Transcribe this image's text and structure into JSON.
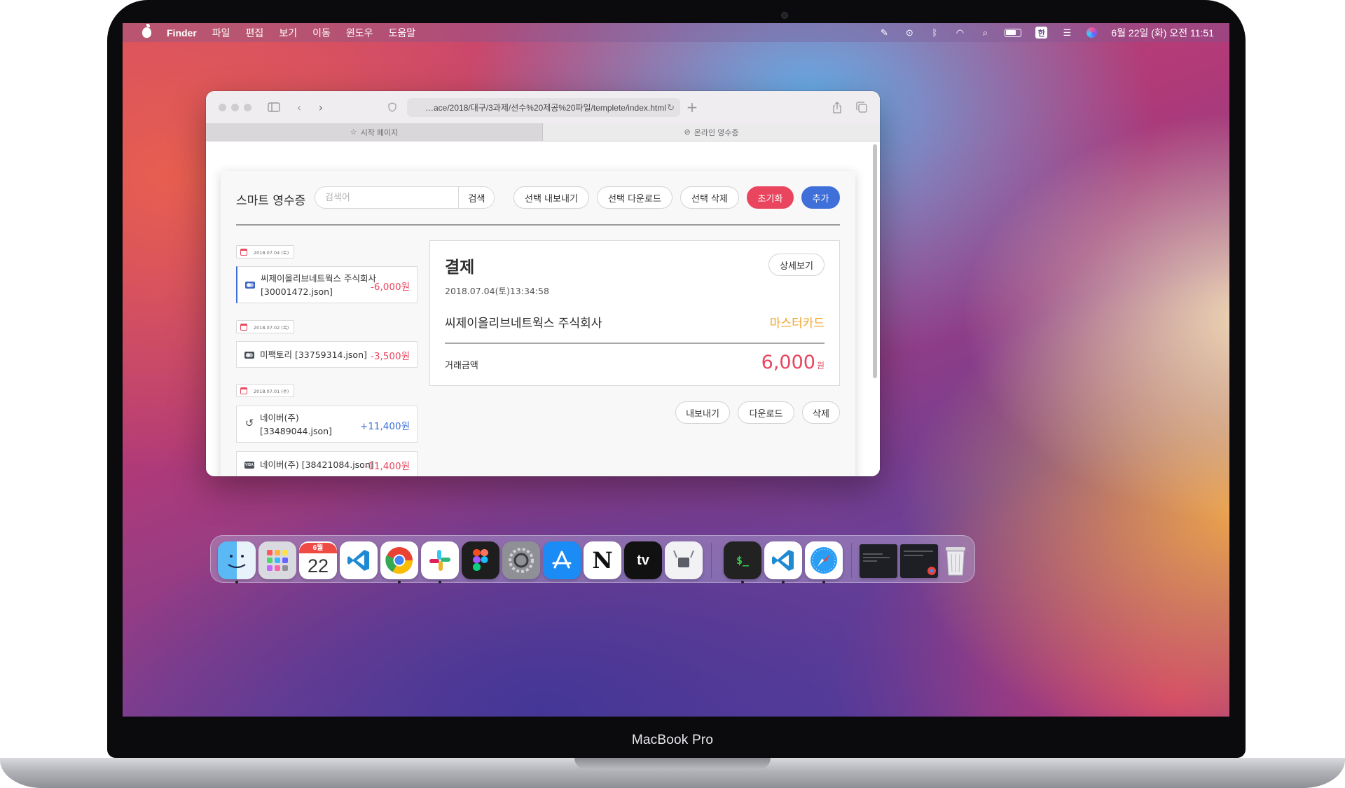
{
  "menubar": {
    "app_name": "Finder",
    "menus": [
      "파일",
      "편집",
      "보기",
      "이동",
      "윈도우",
      "도움말"
    ],
    "ime_label": "한",
    "clock": "6월 22일 (화) 오전 11:51"
  },
  "browser": {
    "url": "…ace/2018/대구/3과제/선수%20제공%20파일/templete/index.html",
    "tabs": [
      {
        "label": "시작 페이지",
        "icon": "star-icon"
      },
      {
        "label": "온라인 영수증",
        "icon": "compass-icon"
      }
    ]
  },
  "app": {
    "title": "스마트 영수증",
    "search": {
      "placeholder": "검색어",
      "button": "검색"
    },
    "toolbar": {
      "export_selected": "선택 내보내기",
      "download_selected": "선택 다운로드",
      "delete_selected": "선택 삭제",
      "reset": "초기화",
      "add": "추가"
    },
    "groups": [
      {
        "date": "2018.07.04 (토)"
      },
      {
        "date": "2018.07.02 (목)"
      },
      {
        "date": "2018.07.01 (수)"
      }
    ],
    "receipts": [
      {
        "name_line1": "씨제이올리브네트웍스 주식회사",
        "name_line2": "[30001472.json]",
        "amount": "-6,000원",
        "icon": "mastercard-icon"
      },
      {
        "name_line1": "미팩토리 [33759314.json]",
        "name_line2": "",
        "amount": "-3,500원",
        "icon": "card-icon"
      },
      {
        "name_line1": "네이버(주)",
        "name_line2": "[33489044.json]",
        "amount": "+11,400원",
        "icon": "refund-icon"
      },
      {
        "name_line1": "네이버(주) [38421084.json]",
        "name_line2": "",
        "amount": "-11,400원",
        "icon": "visa-icon"
      }
    ],
    "detail": {
      "title": "결제",
      "detail_button": "상세보기",
      "datetime": "2018.07.04(토)13:34:58",
      "merchant": "씨제이올리브네트웍스 주식회사",
      "card": "마스터카드",
      "amount_label": "거래금액",
      "amount": "6,000",
      "amount_unit": "원"
    },
    "actions": {
      "export": "내보내기",
      "download": "다운로드",
      "delete": "삭제"
    }
  },
  "dock": {
    "calendar_month": "6월",
    "calendar_day": "22",
    "apps": [
      "Finder",
      "Launchpad",
      "Calendar",
      "Visual Studio Code",
      "Google Chrome",
      "Slack",
      "Figma",
      "System Preferences",
      "App Store",
      "Notion",
      "Apple TV",
      "System Information",
      "Terminal",
      "Visual Studio Code",
      "Safari",
      "Trash"
    ],
    "appletv_label": "tv",
    "notion_label": "N",
    "terminal_label": "$_"
  },
  "device": {
    "label": "MacBook Pro"
  },
  "colors": {
    "accent_red": "#e9455e",
    "accent_blue": "#3f6fd9",
    "card_orange": "#f0a52e"
  }
}
